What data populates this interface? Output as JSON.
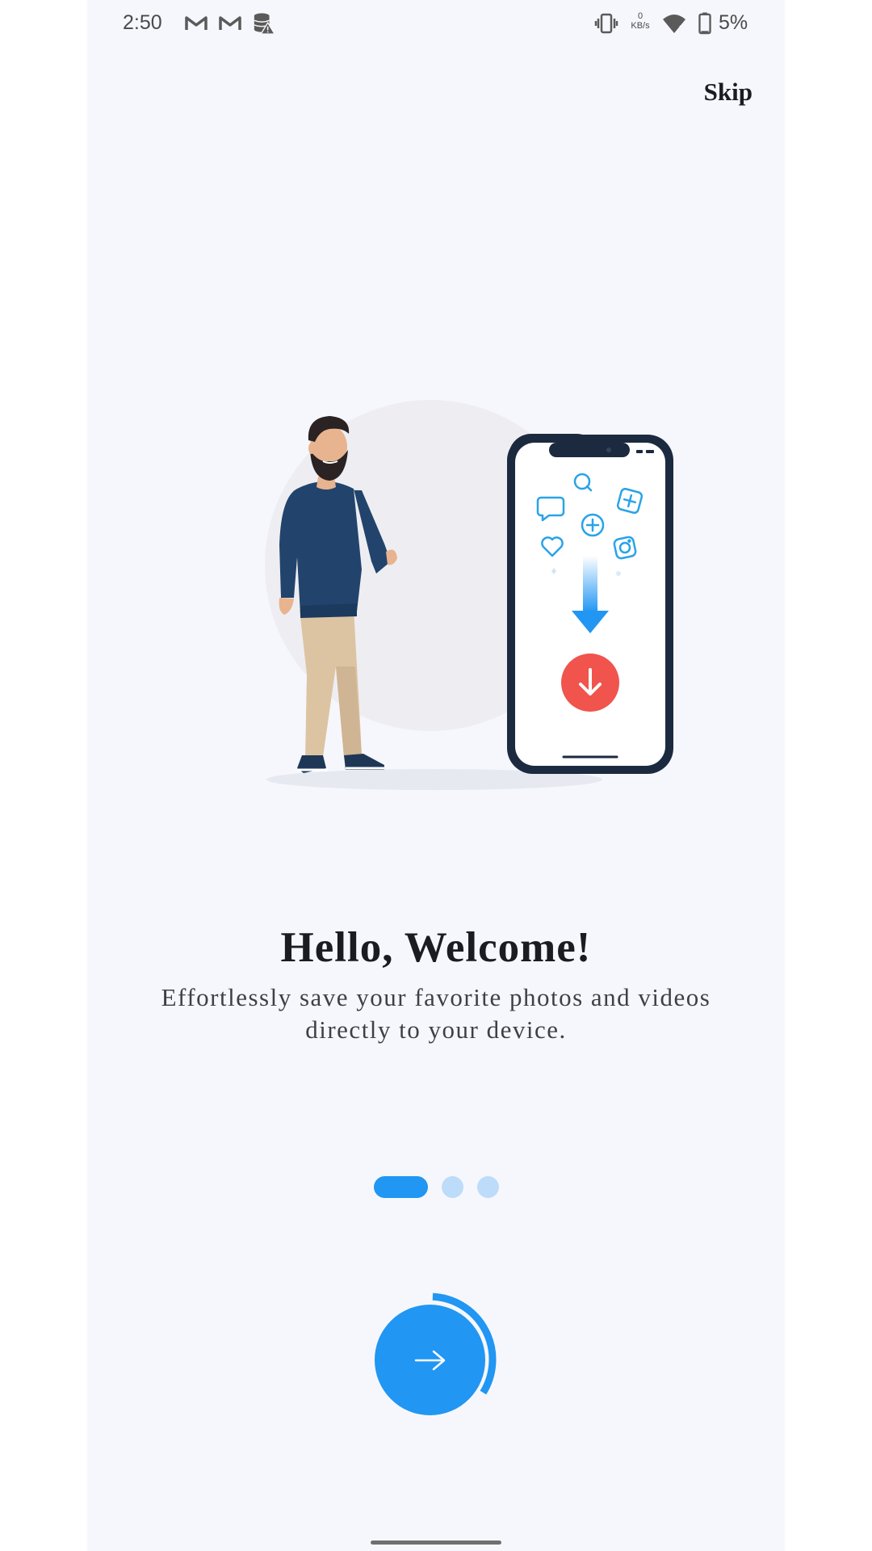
{
  "status_bar": {
    "time": "2:50",
    "net_speed_value": "0",
    "net_speed_unit": "KB/s",
    "battery_percent": "5%",
    "icons": [
      "gmail-icon",
      "gmail-icon",
      "data-warning-icon",
      "vibrate-icon",
      "wifi-icon",
      "battery-icon"
    ]
  },
  "header": {
    "skip_label": "Skip"
  },
  "onboarding": {
    "title": "Hello, Welcome!",
    "subtitle": "Effortlessly save your favorite photos and videos directly to your device.",
    "current_page": 1,
    "total_pages": 3,
    "progress_fraction": 0.33
  },
  "colors": {
    "accent": "#2196f3",
    "dot_inactive": "#bcdcf9",
    "download_red": "#f0544c",
    "background": "#f6f7fc"
  },
  "icons": {
    "next": "arrow-right-icon",
    "download": "download-arrow-icon"
  }
}
